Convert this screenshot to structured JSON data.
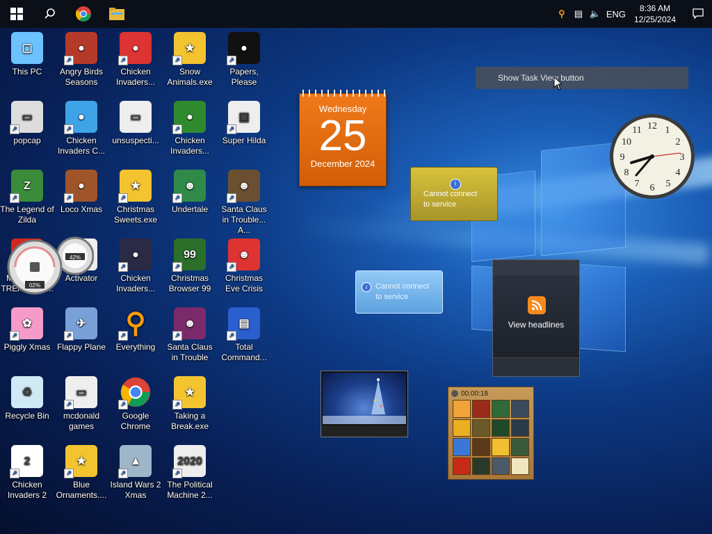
{
  "taskbar": {
    "start_icon": "windows-logo",
    "search_icon": "search-icon",
    "pinned": [
      {
        "name": "chrome-icon"
      },
      {
        "name": "file-explorer-icon"
      }
    ],
    "tray": {
      "lang": "ENG",
      "time": "8:36 AM",
      "date": "12/25/2024"
    }
  },
  "tooltip": {
    "text": "Show Task View button"
  },
  "desktop_icons": [
    {
      "label": "This PC"
    },
    {
      "label": "popcap"
    },
    {
      "label": "The Legend of Zilda"
    },
    {
      "label": "MCDONAL TREASURE..."
    },
    {
      "label": "Piggly Xmas"
    },
    {
      "label": "Recycle Bin"
    },
    {
      "label": "Chicken Invaders 2"
    },
    {
      "label": "Angry Birds Seasons"
    },
    {
      "label": "Chicken Invaders C..."
    },
    {
      "label": "Loco Xmas"
    },
    {
      "label": "Activator"
    },
    {
      "label": "Flappy Plane"
    },
    {
      "label": "mcdonald games"
    },
    {
      "label": "Blue Ornaments...."
    },
    {
      "label": "Chicken Invaders..."
    },
    {
      "label": "unsuspecti..."
    },
    {
      "label": "Christmas Sweets.exe"
    },
    {
      "label": "Chicken Invaders..."
    },
    {
      "label": "Everything"
    },
    {
      "label": "Google Chrome"
    },
    {
      "label": "Island Wars 2 Xmas"
    },
    {
      "label": "Snow Animals.exe"
    },
    {
      "label": "Chicken Invaders..."
    },
    {
      "label": "Undertale"
    },
    {
      "label": "Christmas Browser 99"
    },
    {
      "label": "Santa Claus in Trouble"
    },
    {
      "label": "Taking a Break.exe"
    },
    {
      "label": "The Political Machine 2..."
    },
    {
      "label": "Papers, Please"
    },
    {
      "label": "Super Hilda"
    },
    {
      "label": "Santa Claus in Trouble... A..."
    },
    {
      "label": "Christmas Eve Crisis"
    },
    {
      "label": "Total Command..."
    }
  ],
  "gadgets": {
    "calendar": {
      "weekday": "Wednesday",
      "day": "25",
      "month_year": "December 2024"
    },
    "weather_gold": {
      "line1": "Cannot connect",
      "line2": "to service"
    },
    "weather_blue": {
      "line1": "Cannot connect",
      "line2": "to service"
    },
    "feed": {
      "label": "View headlines"
    },
    "meters": {
      "cpu": "02%",
      "mem": "42%"
    },
    "puzzle": {
      "timer": "00:00:18"
    }
  },
  "colors": {
    "calendar": "#e8700f",
    "weather_gold": "#c9b235",
    "taskbar": "#0b0f17"
  }
}
